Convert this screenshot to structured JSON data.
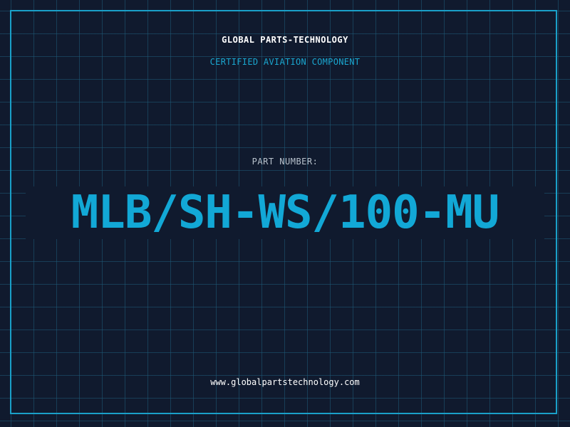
{
  "header": {
    "company": "GLOBAL PARTS-TECHNOLOGY",
    "tagline": "CERTIFIED AVIATION COMPONENT"
  },
  "part": {
    "label": "PART NUMBER:",
    "number": "MLB/SH-WS/100-MU"
  },
  "footer": {
    "website": "www.globalpartstechnology.com"
  },
  "colors": {
    "background": "#101a2e",
    "grid": "#1e5a78",
    "accent": "#12a8d6",
    "title_text": "#ffffff",
    "label_text": "#b8c2cc"
  }
}
